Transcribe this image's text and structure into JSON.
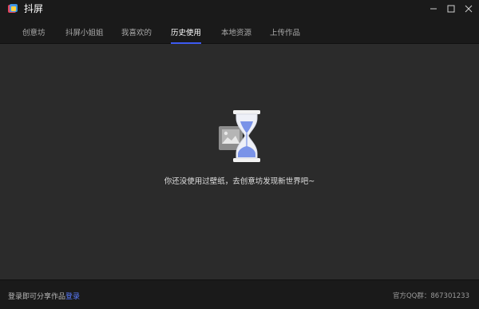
{
  "app": {
    "title": "抖屏",
    "logo_icon": "doupin-logo-icon"
  },
  "window_controls": {
    "minimize_icon": "minimize-icon",
    "maximize_icon": "maximize-icon",
    "close_icon": "close-icon"
  },
  "tabs": [
    {
      "label": "创意坊",
      "active": false
    },
    {
      "label": "抖屏小姐姐",
      "active": false
    },
    {
      "label": "我喜欢的",
      "active": false
    },
    {
      "label": "历史使用",
      "active": true
    },
    {
      "label": "本地资源",
      "active": false
    },
    {
      "label": "上传作品",
      "active": false
    }
  ],
  "main": {
    "empty_icon": "hourglass-icon",
    "empty_message": "你还没使用过壁纸，去创意坊发现新世界吧~"
  },
  "footer": {
    "login_hint": "登录即可分享作品",
    "login_link": "登录",
    "qq_group": "官方QQ群：867301233"
  },
  "colors": {
    "accent": "#3d5af1",
    "link": "#5b7cff",
    "background": "#2b2b2b",
    "bar": "#1a1a1a"
  }
}
